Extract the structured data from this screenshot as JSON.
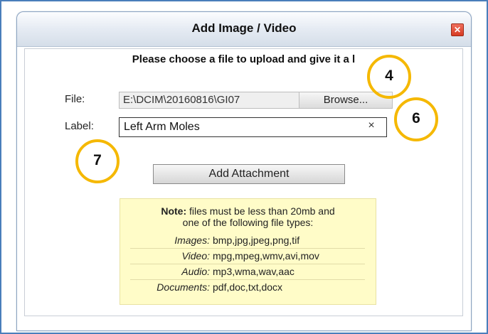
{
  "dialog": {
    "title": "Add Image / Video",
    "close_label": "✕",
    "instruction": "Please choose a file to upload and give it a l",
    "file_label": "File:",
    "file_value": "E:\\DCIM\\20160816\\GI07",
    "browse_label": "Browse...",
    "label_label": "Label:",
    "label_value": "Left Arm Moles",
    "clear_symbol": "×",
    "add_button": "Add Attachment"
  },
  "note": {
    "bold": "Note:",
    "line1": " files must be less than 20mb and",
    "line2": "one of the following file types:",
    "types": [
      {
        "name": "Images:",
        "value": "bmp,jpg,jpeg,png,tif"
      },
      {
        "name": "Video:",
        "value": "mpg,mpeg,wmv,avi,mov"
      },
      {
        "name": "Audio:",
        "value": "mp3,wma,wav,aac"
      },
      {
        "name": "Documents:",
        "value": "pdf,doc,txt,docx"
      }
    ]
  },
  "callouts": {
    "first": "4",
    "second": "6",
    "third": "7"
  },
  "colors": {
    "callout_ring": "#f5b800",
    "note_background": "#fffcc8",
    "close_button": "#d63a22",
    "frame": "#4a7ebb"
  }
}
